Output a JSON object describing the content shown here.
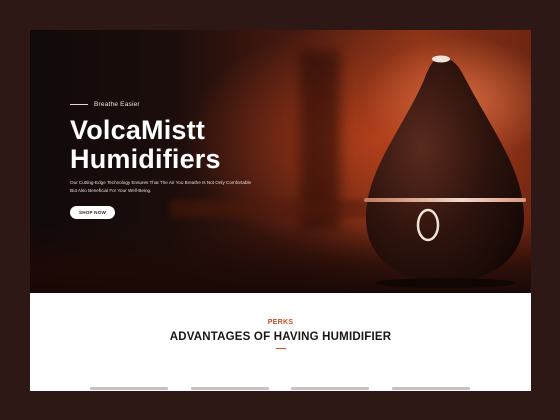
{
  "hero": {
    "eyebrow": "Breathe Easier",
    "title_line1": "VolcaMistt",
    "title_line2": "Humidifiers",
    "subtitle_line1": "Our Cutting-Edge Technology Ensures That The Air You Breathe Is Not Only Comfortable",
    "subtitle_line2": "But Also Beneficial For Your Well-Being.",
    "cta_label": "SHOP NOW"
  },
  "perks": {
    "eyebrow": "PERKS",
    "title": "ADVANTAGES OF HAVING HUMIDIFIER"
  },
  "colors": {
    "page_background": "#2e1816",
    "accent": "#d04a22",
    "title_text": "#1c1614"
  }
}
